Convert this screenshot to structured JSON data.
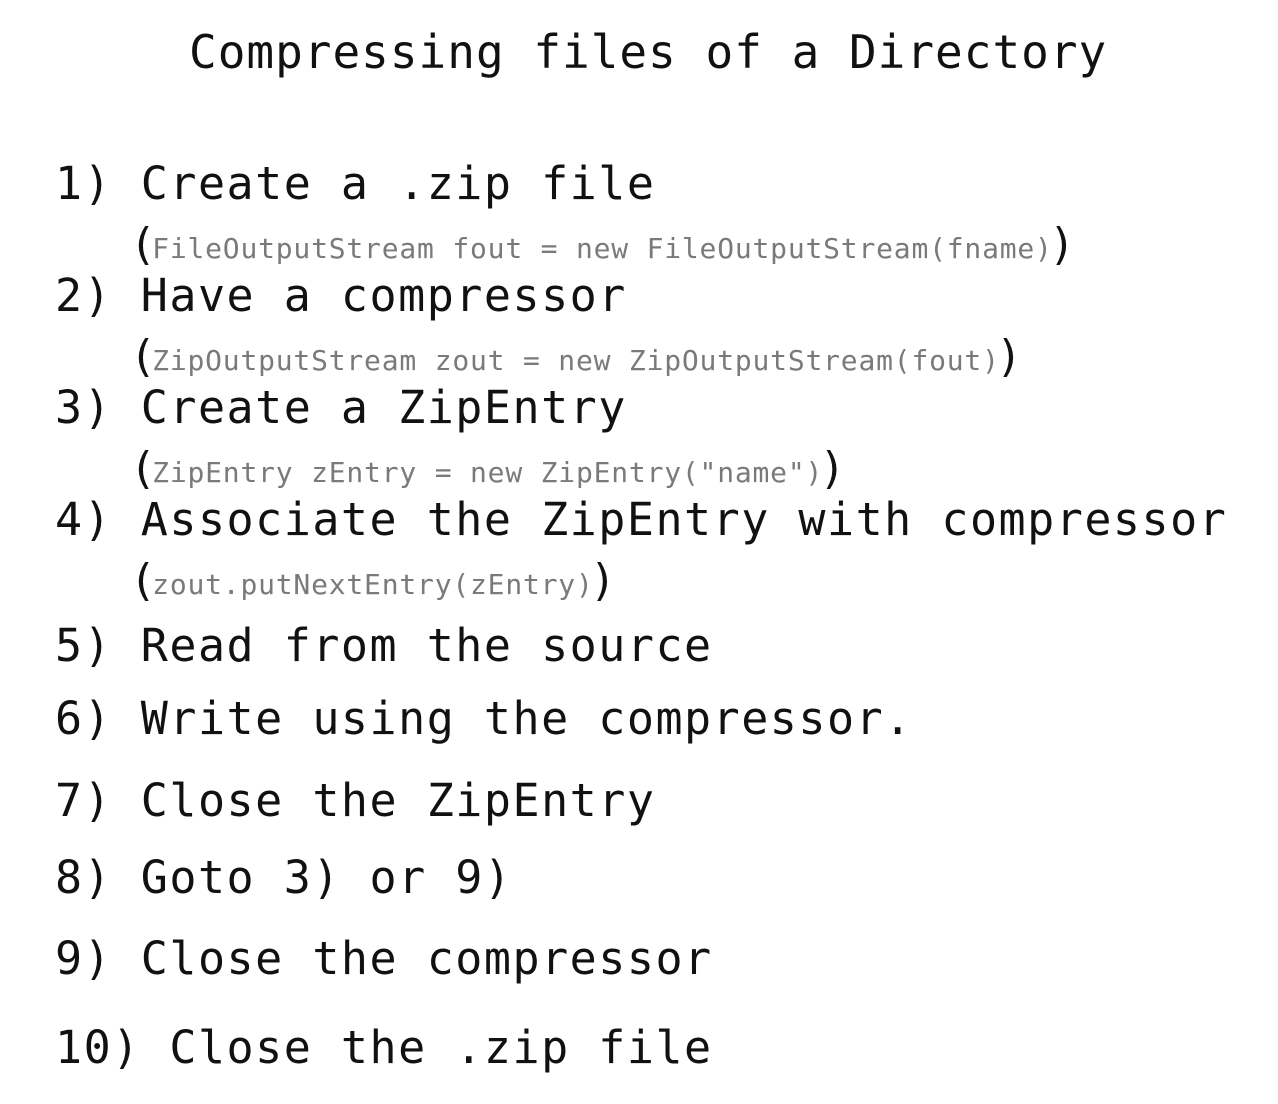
{
  "title": "Compressing files of a Directory",
  "steps": [
    {
      "label": "1) Create a .zip file",
      "code": "FileOutputStream fout = new FileOutputStream(fname)"
    },
    {
      "label": "2) Have a compressor",
      "code": "ZipOutputStream zout = new ZipOutputStream(fout)"
    },
    {
      "label": "3) Create a ZipEntry",
      "code": "ZipEntry zEntry = new ZipEntry(\"name\")"
    },
    {
      "label": "4) Associate the ZipEntry with compressor",
      "code": "zout.putNextEntry(zEntry)"
    },
    {
      "label": "5) Read from the source"
    },
    {
      "label": "6) Write using the compressor."
    },
    {
      "label": "7) Close the ZipEntry"
    },
    {
      "label": "8) Goto 3) or 9)"
    },
    {
      "label": "9) Close the compressor"
    },
    {
      "label": "10) Close the .zip file"
    }
  ],
  "paren_open": "(",
  "paren_close": ")"
}
